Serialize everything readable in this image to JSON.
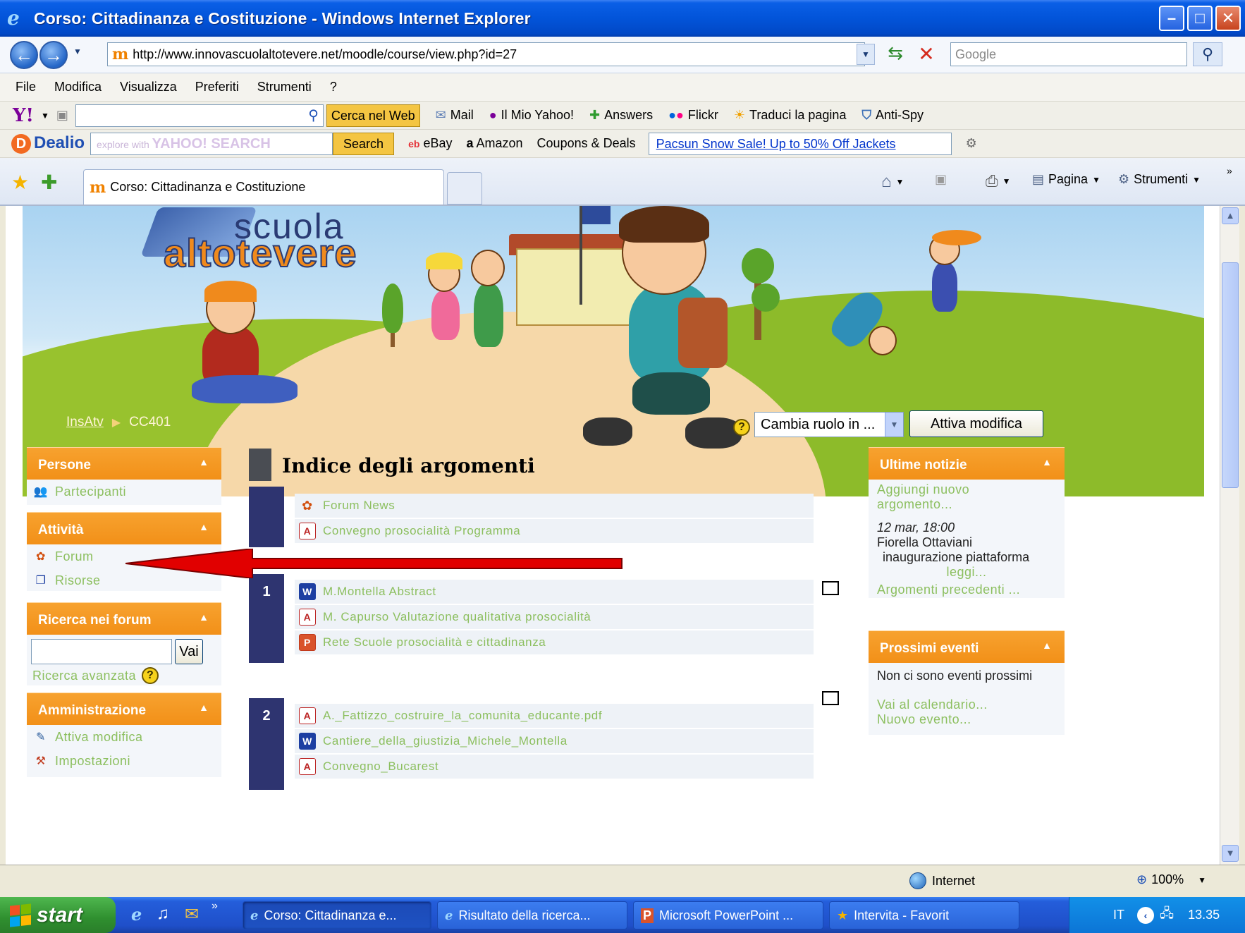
{
  "window": {
    "title": "Corso: Cittadinanza e Costituzione - Windows Internet Explorer"
  },
  "address": {
    "url": "http://www.innovascuolaltotevere.net/moodle/course/view.php?id=27",
    "search_placeholder": "Google"
  },
  "menu": [
    "File",
    "Modifica",
    "Visualizza",
    "Preferiti",
    "Strumenti",
    "?"
  ],
  "yahoo_toolbar": {
    "search_button": "Cerca nel Web",
    "links": [
      "Mail",
      "Il Mio Yahoo!",
      "Answers",
      "Flickr",
      "Traduci la pagina",
      "Anti-Spy"
    ]
  },
  "dealio_toolbar": {
    "logo": "Dealio",
    "search_hint": "explore with",
    "search_brand": "YAHOO! SEARCH",
    "search_button": "Search",
    "links": [
      "eBay",
      "Amazon",
      "Coupons & Deals"
    ],
    "promo": "Pacsun Snow Sale! Up to 50% Off Jackets"
  },
  "tabs": {
    "active": "Corso: Cittadinanza e Costituzione",
    "commands": [
      "Pagina",
      "Strumenti"
    ]
  },
  "banner": {
    "logo_top": "scuola",
    "logo_bottom": "altotevere",
    "breadcrumb": [
      "InsAtv",
      "CC401"
    ],
    "role_select": "Cambia ruolo in ...",
    "edit_button": "Attiva modifica"
  },
  "left": {
    "persone": {
      "title": "Persone",
      "items": [
        "Partecipanti"
      ]
    },
    "attivita": {
      "title": "Attività",
      "items": [
        "Forum",
        "Risorse"
      ]
    },
    "ricerca": {
      "title": "Ricerca nei forum",
      "button": "Vai",
      "advanced": "Ricerca avanzata"
    },
    "amministrazione": {
      "title": "Amministrazione",
      "items": [
        "Attiva modifica",
        "Impostazioni"
      ]
    }
  },
  "main": {
    "title": "Indice degli argomenti",
    "section0": [
      "Forum News",
      "Convegno prosocialità Programma"
    ],
    "section1": {
      "num": "1",
      "items": [
        "M.Montella Abstract",
        "M. Capurso Valutazione qualitativa prosocialità",
        "Rete Scuole prosocialità e cittadinanza"
      ]
    },
    "section2": {
      "num": "2",
      "items": [
        "A._Fattizzo_costruire_la_comunita_educante.pdf",
        "Cantiere_della_giustizia_Michele_Montella",
        "Convegno_Bucarest"
      ]
    }
  },
  "right": {
    "news": {
      "title": "Ultime notizie",
      "add_line1": "Aggiungi nuovo",
      "add_line2": "argomento...",
      "date": "12 mar, 18:00",
      "author": "Fiorella Ottaviani",
      "subject": "inaugurazione piattaforma",
      "read_more": "leggi...",
      "older": "Argomenti precedenti ..."
    },
    "events": {
      "title": "Prossimi eventi",
      "none": "Non ci sono eventi prossimi",
      "calendar": "Vai al calendario...",
      "new_event": "Nuovo evento..."
    }
  },
  "status": {
    "zone": "Internet",
    "zoom": "100%"
  },
  "taskbar": {
    "start": "start",
    "tasks": [
      "Corso: Cittadinanza e...",
      "Risultato della ricerca...",
      "Microsoft PowerPoint ...",
      "Intervita - Favorit"
    ],
    "lang": "IT",
    "clock": "13.35"
  }
}
